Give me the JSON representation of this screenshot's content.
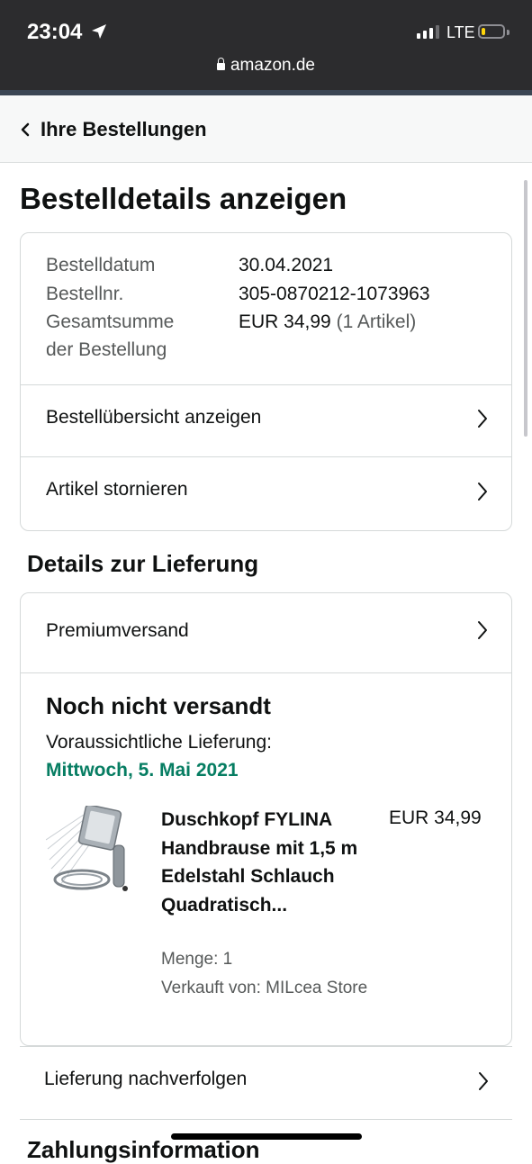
{
  "status_bar": {
    "time": "23:04",
    "network": "LTE",
    "url": "amazon.de",
    "battery_level": 0.2
  },
  "nav": {
    "back_label": "Ihre Bestellungen"
  },
  "page_title": "Bestelldetails anzeigen",
  "order_summary": {
    "date_label": "Bestelldatum",
    "date_value": "30.04.2021",
    "number_label": "Bestellnr.",
    "number_value": "305-0870212-1073963",
    "total_label_line1": "Gesamtsumme",
    "total_label_line2": "der Bestellung",
    "total_value": "EUR 34,99",
    "total_items": "(1 Artikel)",
    "links": [
      {
        "label": "Bestellübersicht anzeigen"
      },
      {
        "label": "Artikel stornieren"
      }
    ]
  },
  "delivery": {
    "section_title": "Details zur Lieferung",
    "shipping_method": "Premiumversand",
    "status": "Noch nicht versandt",
    "expected_label": "Voraussichtliche Lieferung:",
    "expected_date": "Mittwoch, 5. Mai 2021",
    "product": {
      "title": "Duschkopf FYLINA Handbrause mit 1,5 m Edelstahl Schlauch Quadratisch...",
      "price": "EUR 34,99",
      "quantity": "Menge: 1",
      "seller": "Verkauft von: MILcea Store"
    },
    "track_label": "Lieferung nachverfolgen"
  },
  "next_section_title": "Zahlungsinformation",
  "colors": {
    "accent_green": "#067d62",
    "text": "#0f1111",
    "muted": "#565959",
    "border": "#d5d9d9"
  }
}
